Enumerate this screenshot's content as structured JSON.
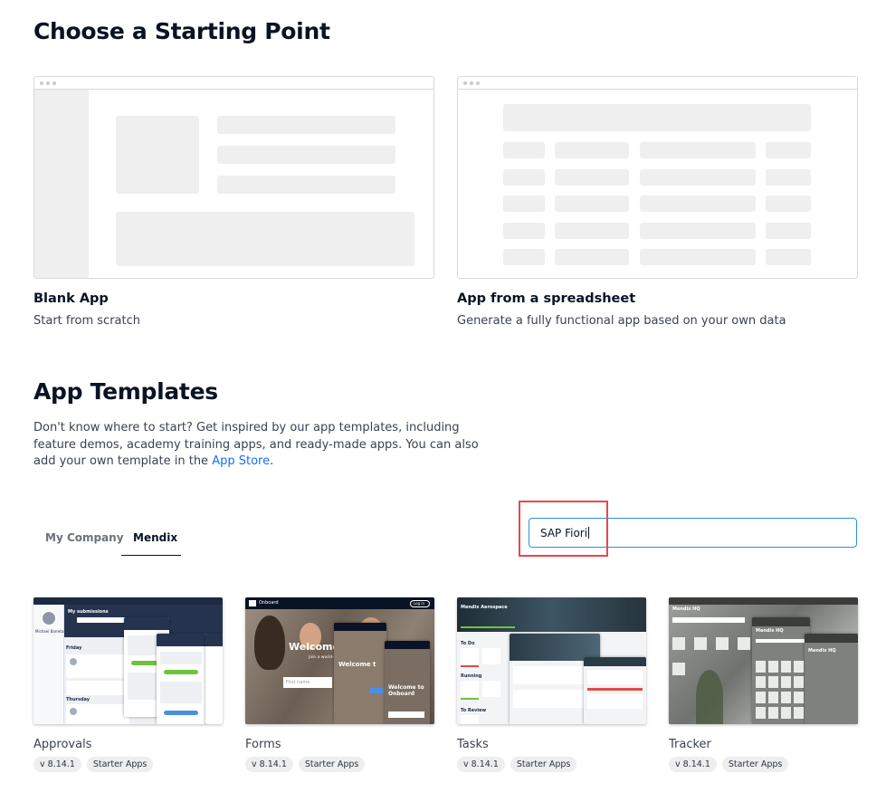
{
  "starting_point": {
    "title": "Choose a Starting Point",
    "cards": [
      {
        "title": "Blank App",
        "description": "Start from scratch"
      },
      {
        "title": "App from a spreadsheet",
        "description": "Generate a fully functional app based on your own data"
      }
    ]
  },
  "templates_section": {
    "title": "App Templates",
    "intro_text": "Don't know where to start? Get inspired by our app templates, including feature demos, academy training apps, and ready-made apps. You can also add your own template in the ",
    "link_text": "App Store",
    "intro_end": "."
  },
  "tabs": [
    {
      "label": "My Company",
      "active": false
    },
    {
      "label": "Mendix",
      "active": true
    }
  ],
  "search": {
    "value": "SAP Fiori"
  },
  "templates": [
    {
      "name": "Approvals",
      "version": "v 8.14.1",
      "category": "Starter Apps",
      "thumb": {
        "header": "My submissions",
        "user": "Michael Barreta",
        "day1": "Friday",
        "day2": "Thursday"
      }
    },
    {
      "name": "Forms",
      "version": "v 8.14.1",
      "category": "Starter Apps",
      "thumb": {
        "brand": "Onboard",
        "login": "Log in",
        "welcome": "Welcome",
        "sub": "Join a world-class",
        "field": "First name"
      }
    },
    {
      "name": "Tasks",
      "version": "v 8.14.1",
      "category": "Starter Apps",
      "thumb": {
        "brand": "Mendix Aerospace",
        "col1": "To Do",
        "col2": "Running",
        "col3": "To Review"
      }
    },
    {
      "name": "Tracker",
      "version": "v 8.14.1",
      "category": "Starter Apps",
      "thumb": {
        "brand": "Mendix HQ"
      }
    }
  ],
  "colors": {
    "link": "#146ff4",
    "search_border": "#2c91d6",
    "highlight": "#e34b4b",
    "accent_green": "#6dc43c"
  }
}
